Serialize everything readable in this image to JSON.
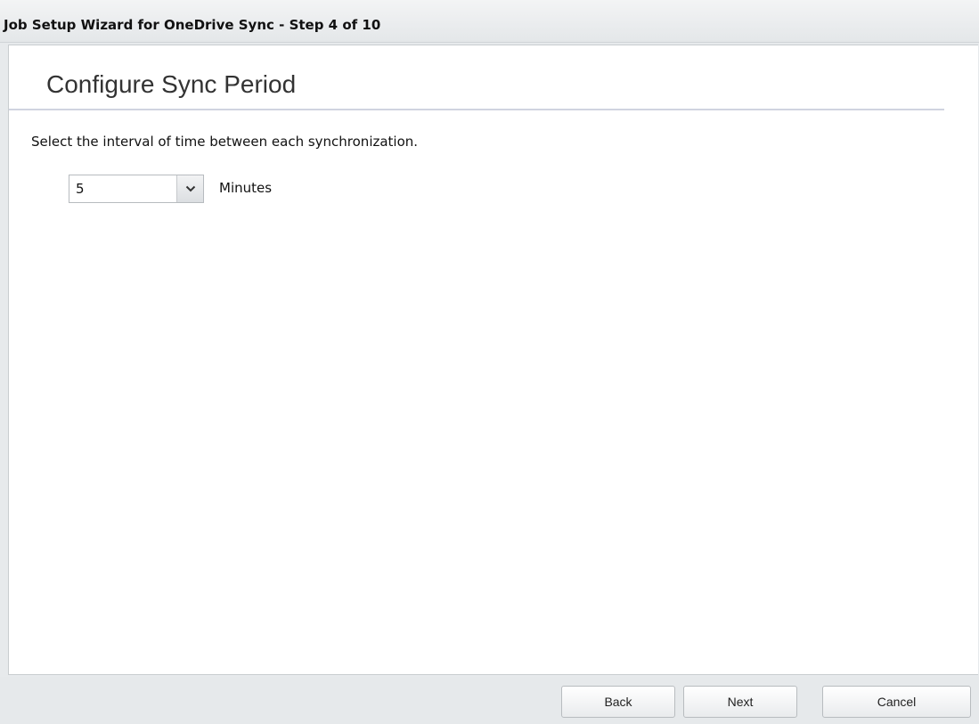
{
  "window": {
    "title": "Job Setup Wizard for OneDrive Sync - Step 4 of 10"
  },
  "page": {
    "title": "Configure Sync Period",
    "instruction": "Select the interval of time between each synchronization."
  },
  "interval": {
    "selected_value": "5",
    "unit_label": "Minutes"
  },
  "buttons": {
    "back": "Back",
    "next": "Next",
    "cancel": "Cancel"
  },
  "icons": {
    "dropdown": "chevron-down-icon"
  }
}
